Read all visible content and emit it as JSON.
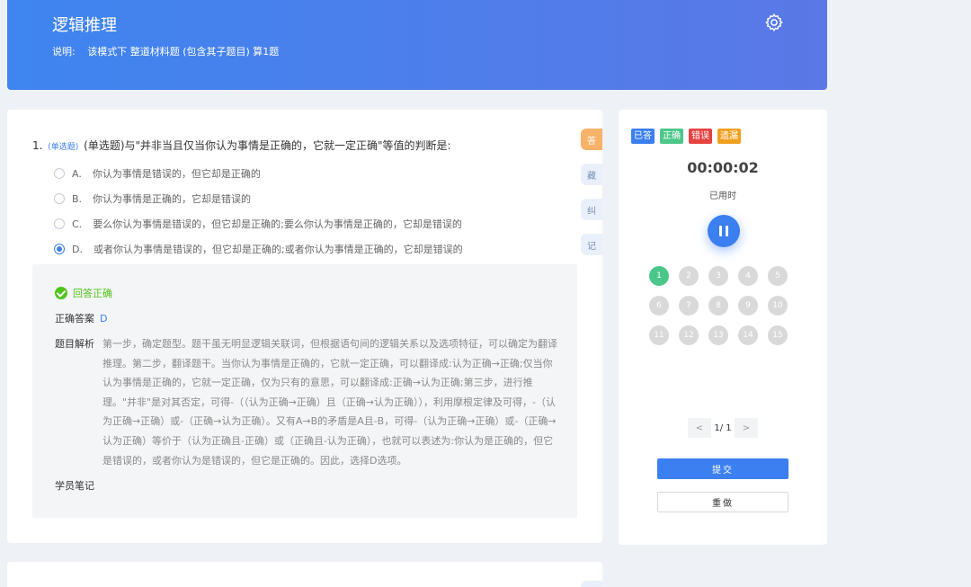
{
  "header": {
    "title": "逻辑推理",
    "desc_label": "说明:",
    "desc_text": "该模式下 整道材料题 (包含其子题目) 算1题"
  },
  "question": {
    "number": "1.",
    "type_tag": "(单选题)",
    "text": "(单选题)与\"并非当且仅当你认为事情是正确的，它就一定正确\"等值的判断是:",
    "options": [
      {
        "letter": "A.",
        "text": "你认为事情是错误的，但它却是正确的",
        "selected": false
      },
      {
        "letter": "B.",
        "text": "你认为事情是正确的，它却是错误的",
        "selected": false
      },
      {
        "letter": "C.",
        "text": "要么你认为事情是错误的，但它却是正确的;要么你认为事情是正确的，它却是错误的",
        "selected": false
      },
      {
        "letter": "D.",
        "text": "或者你认为事情是错误的，但它却是正确的;或者你认为事情是正确的，它却是错误的",
        "selected": true
      }
    ]
  },
  "answer": {
    "result": "回答正确",
    "correct_label": "正确答案",
    "correct_value": "D",
    "analysis_label": "题目解析",
    "analysis_text": "第一步，确定题型。题干虽无明显逻辑关联词，但根据语句间的逻辑关系以及选项特征，可以确定为翻译推理。第二步，翻译题干。当你认为事情是正确的，它就一定正确，可以翻译成:认为正确→正确;仅当你认为事情是正确的，它就一定正确，仅为只有的意思，可以翻译成:正确→认为正确;第三步，进行推理。\"并非\"是对其否定，可得-（（认为正确→正确）且（正确→认为正确）），利用摩根定律及可得，-（认为正确→正确）或-（正确→认为正确）。又有A→B的矛盾是A且-B，可得-（认为正确→正确）或-（正确→认为正确）等价于（认为正确且-正确）或（正确且-认为正确），也就可以表述为:你认为是正确的，但它是错误的，或者你认为是错误的，但它是正确的。因此，选择D选项。",
    "notes_label": "学员笔记"
  },
  "side_buttons": [
    "答",
    "藏",
    "纠",
    "记"
  ],
  "legend": [
    {
      "label": "已答",
      "color": "#3b7ff0"
    },
    {
      "label": "正确",
      "color": "#4cc78a"
    },
    {
      "label": "错误",
      "color": "#e64242"
    },
    {
      "label": "遗漏",
      "color": "#f0a020"
    }
  ],
  "timer": {
    "value": "00:00:02",
    "label": "已用时"
  },
  "numbers": [
    "1",
    "2",
    "3",
    "4",
    "5",
    "6",
    "7",
    "8",
    "9",
    "10",
    "11",
    "12",
    "13",
    "14",
    "15"
  ],
  "answered": [
    1
  ],
  "pager": {
    "prev": "<",
    "text": "1/ 1",
    "next": ">"
  },
  "buttons": {
    "submit": "提交",
    "redo": "重做"
  }
}
